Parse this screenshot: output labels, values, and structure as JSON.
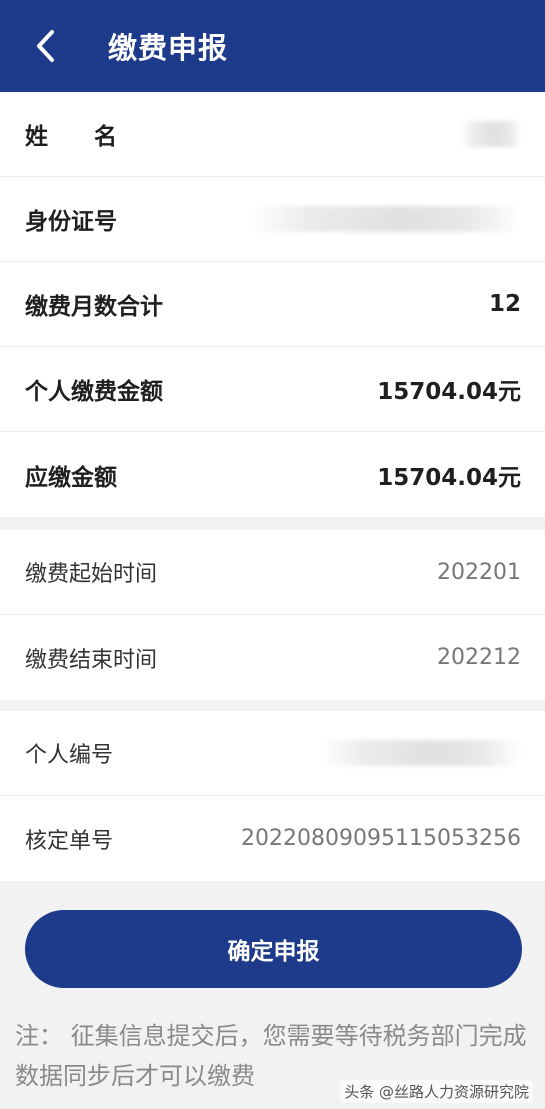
{
  "header": {
    "title": "缴费申报"
  },
  "group1": {
    "name_label_a": "姓",
    "name_label_b": "名",
    "id_label": "身份证号",
    "months_label": "缴费月数合计",
    "months_value": "12",
    "personal_label": "个人缴费金额",
    "personal_value": "15704.04元",
    "due_label": "应缴金额",
    "due_value": "15704.04元"
  },
  "group2": {
    "start_label": "缴费起始时间",
    "start_value": "202201",
    "end_label": "缴费结束时间",
    "end_value": "202212"
  },
  "group3": {
    "personal_no_label": "个人编号",
    "assess_no_label": "核定单号",
    "assess_no_value": "20220809095115053256"
  },
  "submit_label": "确定申报",
  "note": "注：    征集信息提交后，您需要等待税务部门完成数据同步后才可以缴费",
  "watermark": "头条 @丝路人力资源研究院",
  "colors": {
    "primary": "#1e3a8a",
    "background": "#f2f2f2"
  },
  "icons": {
    "back": "chevron-left-icon"
  }
}
